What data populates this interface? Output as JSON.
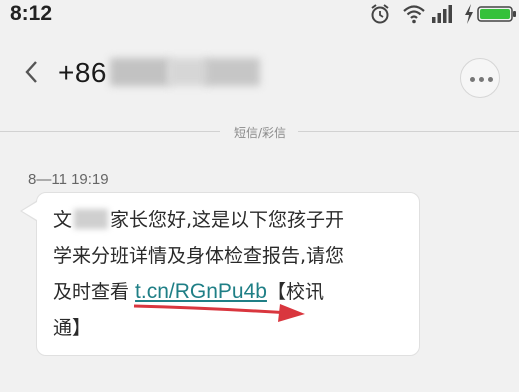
{
  "status_bar": {
    "time": "8:12",
    "icons": [
      "alarm-icon",
      "wifi-icon",
      "signal-icon",
      "charging-icon",
      "battery-icon"
    ],
    "battery_color": "#35c13a"
  },
  "header": {
    "contact_prefix": "+86",
    "back_icon": "chevron-left-icon",
    "more_icon": "more-icon"
  },
  "thread": {
    "divider_label": "短信/彩信",
    "timestamp": "8—11 19:19",
    "message": {
      "line1_start": "文",
      "line1_end": "家长您好,这是以下您孩子开",
      "line2": "学来分班详情及身体检查报告,请您",
      "line3_prefix": "及时查看 ",
      "link": "t.cn/RGnPu4b",
      "line3_suffix": "【校讯",
      "line4": "通】"
    },
    "link_color": "#1f7f86",
    "annotation_arrow_color": "#d9363e"
  }
}
